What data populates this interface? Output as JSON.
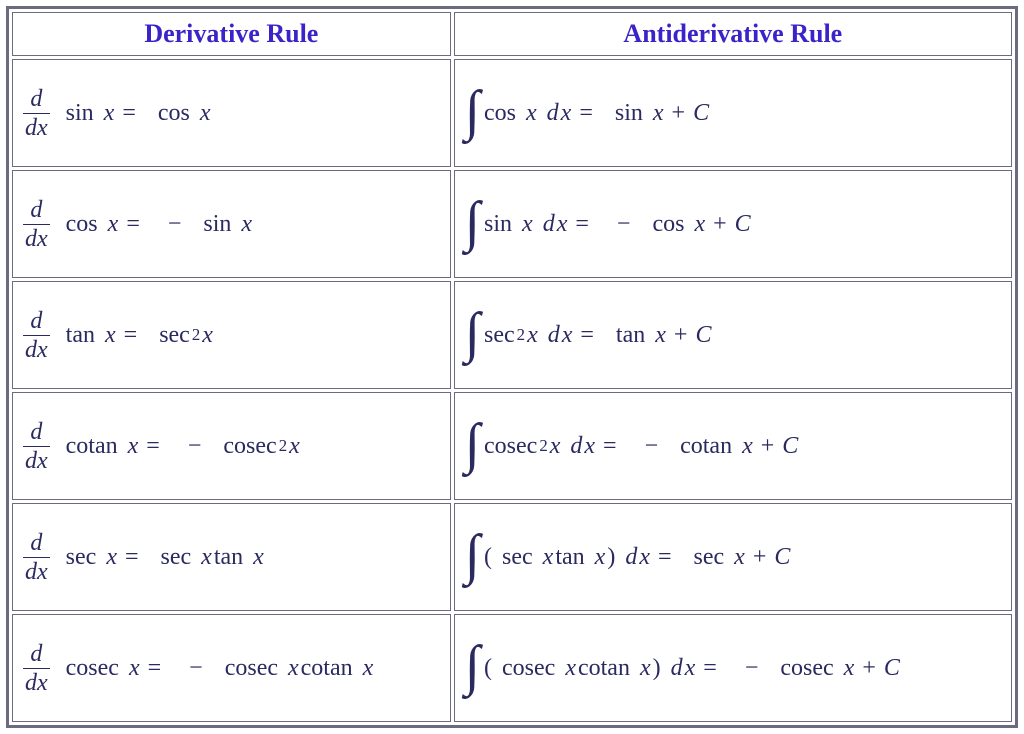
{
  "headers": {
    "derivative": "Derivative Rule",
    "antiderivative": "Antiderivative Rule"
  },
  "chart_data": {
    "type": "table",
    "columns": [
      "Derivative Rule",
      "Antiderivative Rule"
    ],
    "rows": [
      {
        "derivative": "d/dx sin x = cos x",
        "antiderivative": "∫ cos x dx = sin x + C"
      },
      {
        "derivative": "d/dx cos x = − sin x",
        "antiderivative": "∫ sin x dx = − cos x + C"
      },
      {
        "derivative": "d/dx tan x = sec²x",
        "antiderivative": "∫ sec²x dx = tan x + C"
      },
      {
        "derivative": "d/dx cotan x = − cosec²x",
        "antiderivative": "∫ cosec²x dx = − cotan x + C"
      },
      {
        "derivative": "d/dx sec x = sec x tan x",
        "antiderivative": "∫ (sec x tan x) dx = sec x + C"
      },
      {
        "derivative": "d/dx cosec x = − cosec x cotan x",
        "antiderivative": "∫ (cosec x cotan x) dx = − cosec x + C"
      }
    ]
  },
  "sym": {
    "d": "d",
    "dx": "dx",
    "x": "x",
    "eq": "=",
    "minus": "−",
    "plus": "+",
    "C": "C",
    "int": "∫",
    "lpar": "(",
    "rpar": ")",
    "sq": "2"
  },
  "fn": {
    "sin": "sin",
    "cos": "cos",
    "tan": "tan",
    "sec": "sec",
    "cotan": "cotan",
    "cosec": "cosec"
  }
}
